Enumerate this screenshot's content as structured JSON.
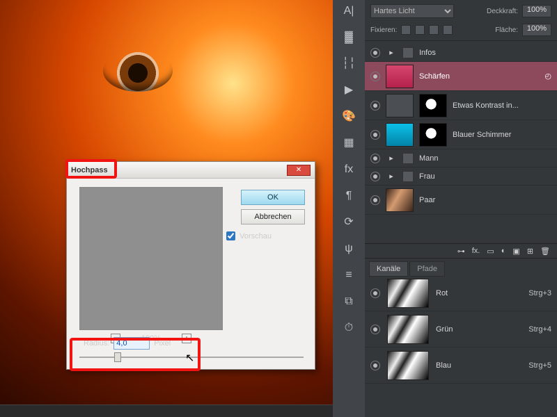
{
  "dialog": {
    "title": "Hochpass",
    "ok": "OK",
    "cancel": "Abbrechen",
    "previewLabel": "Vorschau",
    "zoom": "100%",
    "radiusLabel": "Radius:",
    "radiusValue": "4,0",
    "radiusUnit": "Pixel"
  },
  "layerOptions": {
    "blendMode": "Hartes Licht",
    "opacityLabel": "Deckkraft:",
    "opacityValue": "100%",
    "lockLabel": "Fixieren:",
    "fillLabel": "Fläche:",
    "fillValue": "100%"
  },
  "layers": [
    {
      "name": "Infos",
      "type": "group"
    },
    {
      "name": "Schärfen",
      "type": "selected"
    },
    {
      "name": "Etwas Kontrast in...",
      "type": "adj"
    },
    {
      "name": "Blauer Schimmer",
      "type": "adj2"
    },
    {
      "name": "Mann",
      "type": "group"
    },
    {
      "name": "Frau",
      "type": "group"
    },
    {
      "name": "Paar",
      "type": "photo"
    }
  ],
  "footerIcons": {
    "link": "⊶",
    "fx": "fx.",
    "mask": "▭",
    "adj": "◐",
    "folder": "▣",
    "new": "⊞",
    "trash": "🗑"
  },
  "tabs": {
    "active": "Kanäle",
    "inactive": "Pfade"
  },
  "channels": [
    {
      "name": "Rot",
      "short": "Strg+3"
    },
    {
      "name": "Grün",
      "short": "Strg+4"
    },
    {
      "name": "Blau",
      "short": "Strg+5"
    }
  ],
  "toolIcons": [
    "A|",
    "▓",
    "┆╎",
    "▶",
    "🎨",
    "▦",
    "fx",
    "¶",
    "⟳",
    "ψ",
    "≡",
    "⧉",
    "⏱"
  ]
}
